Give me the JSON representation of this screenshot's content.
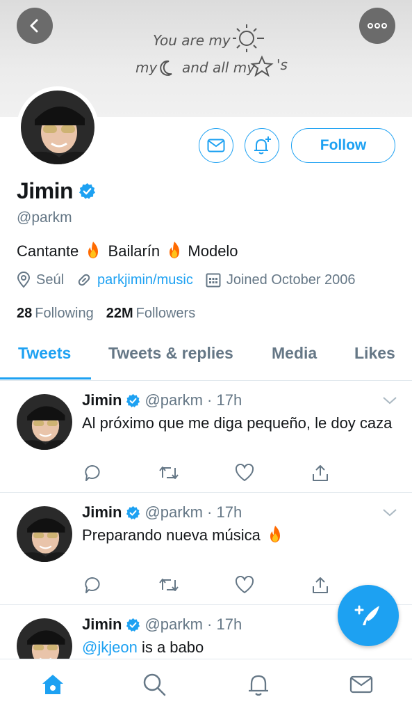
{
  "banner": {
    "line1": "You are my",
    "line2_a": "my",
    "line2_b": "and all my",
    "line2_c": "'s"
  },
  "profile": {
    "name": "Jimin",
    "handle": "@parkm",
    "bio_parts": [
      "Cantante",
      "Bailarín",
      "Modelo"
    ],
    "location": "Seúl",
    "link": "parkjimin/music",
    "joined": "Joined October 2006",
    "following_count": "28",
    "following_label": "Following",
    "followers_count": "22M",
    "followers_label": "Followers",
    "follow_label": "Follow"
  },
  "tabs": [
    {
      "label": "Tweets",
      "active": true
    },
    {
      "label": "Tweets & replies",
      "active": false
    },
    {
      "label": "Media",
      "active": false
    },
    {
      "label": "Likes",
      "active": false
    }
  ],
  "tweets": [
    {
      "name": "Jimin",
      "meta": "@parkm · 17h",
      "text": "Al próximo que me diga pequeño, le doy caza"
    },
    {
      "name": "Jimin",
      "meta": "@parkm · 17h",
      "text": "Preparando nueva música"
    },
    {
      "name": "Jimin",
      "meta": "@parkm · 17h",
      "mention": "@jkjeon",
      "text": "is a babo"
    }
  ],
  "colors": {
    "accent": "#1da1f2",
    "muted": "#657786",
    "fire": "#ff6a00"
  },
  "icons": [
    "back-icon",
    "more-icon",
    "mail-icon",
    "bell-plus-icon",
    "verified-icon",
    "location-icon",
    "link-icon",
    "calendar-icon",
    "reply-icon",
    "retweet-icon",
    "like-icon",
    "share-icon",
    "chevron-down-icon",
    "compose-icon",
    "home-icon",
    "search-icon",
    "notifications-icon",
    "messages-icon",
    "fire-emoji"
  ]
}
